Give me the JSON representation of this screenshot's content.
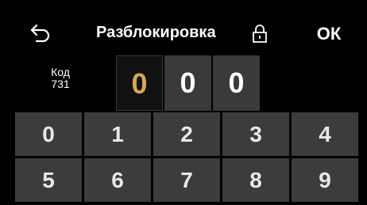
{
  "header": {
    "title": "Разблокировка",
    "ok_label": "ОК"
  },
  "code": {
    "label_line1": "Код",
    "label_line2": "731",
    "digits": [
      "0",
      "0",
      "0"
    ],
    "active_index": 0
  },
  "keypad": {
    "keys": [
      "0",
      "1",
      "2",
      "3",
      "4",
      "5",
      "6",
      "7",
      "8",
      "9"
    ]
  },
  "colors": {
    "background": "#000000",
    "key": "#3c3c3c",
    "digit_box": "#3a3a3a",
    "active_digit": "#d6a659"
  },
  "icons": {
    "back": "back-arrow-icon",
    "lock": "lock-icon"
  }
}
